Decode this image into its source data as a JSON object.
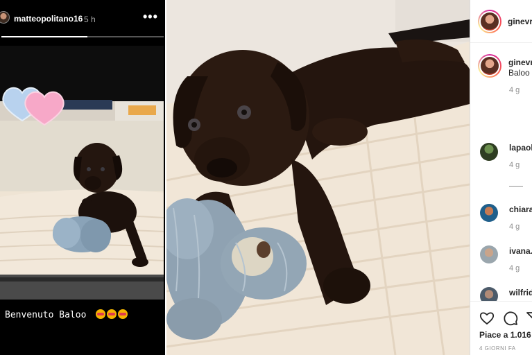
{
  "story": {
    "username": "matteopolitano16",
    "time": "5 h",
    "more_icon": "more-horizontal-icon",
    "progress": 0.53,
    "caption": "Benvenuto Baloo",
    "caption_emojis": [
      "heart-eyes-emoji",
      "heart-eyes-emoji",
      "heart-eyes-emoji"
    ],
    "stickers": [
      "white-heart-sticker",
      "pink-heart-sticker"
    ]
  },
  "post": {
    "header_username": "ginevr",
    "comments": [
      {
        "username": "ginevr",
        "text": "Baloo",
        "meta": "4 g"
      },
      {
        "username": "lapaol",
        "text": "",
        "meta": "4 g"
      },
      {
        "username": "chiara",
        "text": "",
        "meta": "4 g"
      },
      {
        "username": "ivana.",
        "text": "",
        "meta": "4 g"
      },
      {
        "username": "wilfrid",
        "text": "",
        "meta": ""
      }
    ],
    "likes_text": "Piace a 1.016",
    "date_text": "4 GIORNI FA",
    "icons": [
      "heart-icon",
      "comment-icon",
      "share-icon"
    ]
  },
  "colors": {
    "story_bg": "#000000",
    "pink_heart": "#f7a8c8",
    "blue_heart": "#a9c7e8",
    "puppy_brown": "#2e1a12"
  }
}
